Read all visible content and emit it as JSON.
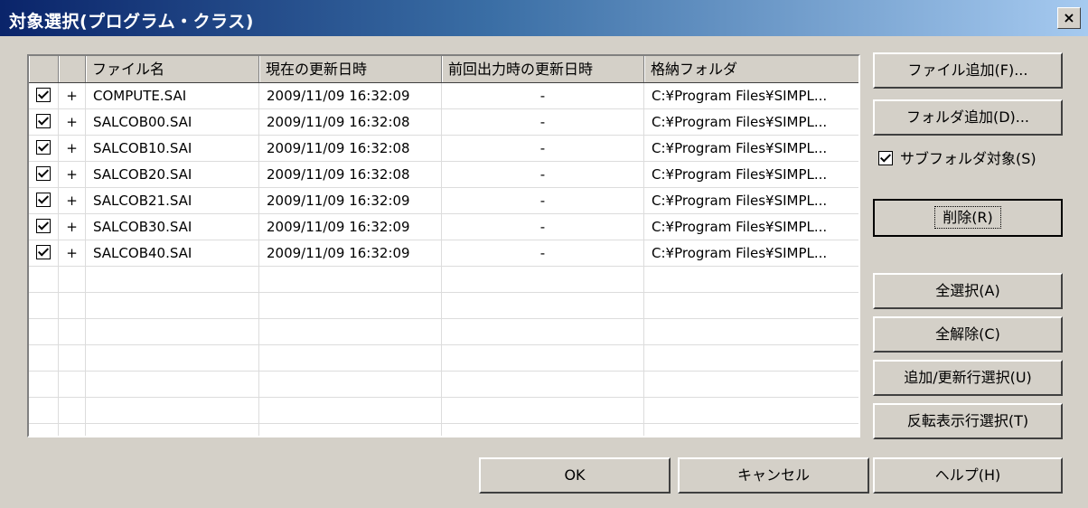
{
  "window": {
    "title": "対象選択(プログラム・クラス)",
    "close_label": "×"
  },
  "grid": {
    "headers": [
      "",
      "",
      "ファイル名",
      "現在の更新日時",
      "前回出力時の更新日時",
      "格納フォルダ"
    ],
    "rows": [
      {
        "checked": true,
        "mark": "+",
        "file": "COMPUTE.SAI",
        "current": "2009/11/09 16:32:09",
        "previous": "-",
        "folder": "C:¥Program Files¥SIMPL..."
      },
      {
        "checked": true,
        "mark": "+",
        "file": "SALCOB00.SAI",
        "current": "2009/11/09 16:32:08",
        "previous": "-",
        "folder": "C:¥Program Files¥SIMPL..."
      },
      {
        "checked": true,
        "mark": "+",
        "file": "SALCOB10.SAI",
        "current": "2009/11/09 16:32:08",
        "previous": "-",
        "folder": "C:¥Program Files¥SIMPL..."
      },
      {
        "checked": true,
        "mark": "+",
        "file": "SALCOB20.SAI",
        "current": "2009/11/09 16:32:08",
        "previous": "-",
        "folder": "C:¥Program Files¥SIMPL..."
      },
      {
        "checked": true,
        "mark": "+",
        "file": "SALCOB21.SAI",
        "current": "2009/11/09 16:32:09",
        "previous": "-",
        "folder": "C:¥Program Files¥SIMPL..."
      },
      {
        "checked": true,
        "mark": "+",
        "file": "SALCOB30.SAI",
        "current": "2009/11/09 16:32:09",
        "previous": "-",
        "folder": "C:¥Program Files¥SIMPL..."
      },
      {
        "checked": true,
        "mark": "+",
        "file": "SALCOB40.SAI",
        "current": "2009/11/09 16:32:09",
        "previous": "-",
        "folder": "C:¥Program Files¥SIMPL..."
      }
    ]
  },
  "side": {
    "add_file": "ファイル追加(F)...",
    "add_folder": "フォルダ追加(D)...",
    "subfolder_label": "サブフォルダ対象(S)",
    "subfolder_checked": true,
    "delete": "削除(R)",
    "select_all": "全選択(A)",
    "deselect_all": "全解除(C)",
    "select_added": "追加/更新行選択(U)",
    "select_inverted": "反転表示行選択(T)"
  },
  "footer": {
    "ok": "OK",
    "cancel": "キャンセル",
    "help": "ヘルプ(H)"
  }
}
